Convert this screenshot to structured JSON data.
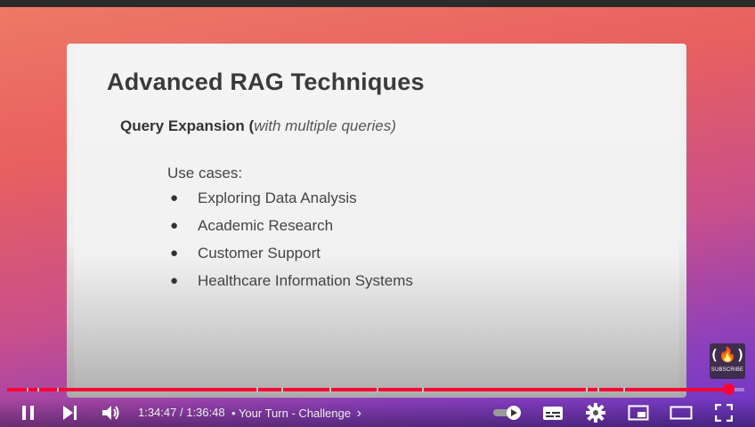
{
  "slide": {
    "title": "Advanced RAG Techniques",
    "subtitle_bold": "Query Expansion (",
    "subtitle_italic": "with multiple queries)",
    "usecases_label": "Use cases:",
    "bullet": "●",
    "items": [
      "Exploring Data Analysis",
      "Academic Research",
      "Customer Support",
      "Healthcare Information Systems"
    ]
  },
  "watermark": {
    "logo": "(🔥)",
    "label": "SUBSCRIBE"
  },
  "player": {
    "current_time": "1:34:47",
    "separator": " / ",
    "duration": "1:36:48",
    "chapter_prefix": "• ",
    "chapter_title": "Your Turn - Challenge",
    "chapter_chevron": "›",
    "progress": 0.978,
    "accent_color": "#ff0033",
    "icons": [
      "pause-icon",
      "next-icon",
      "volume-icon",
      "autoplay-toggle-icon",
      "subtitles-icon",
      "settings-icon",
      "miniplayer-icon",
      "theater-mode-icon",
      "fullscreen-icon"
    ]
  }
}
